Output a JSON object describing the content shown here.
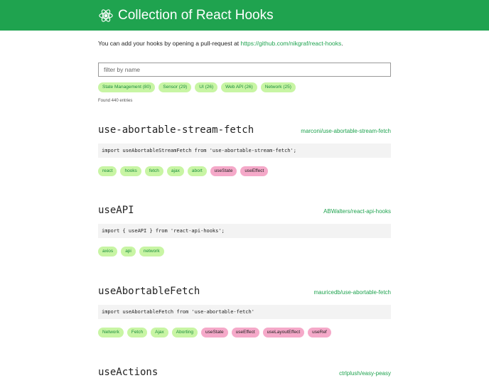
{
  "header": {
    "title": "Collection of React Hooks"
  },
  "intro": {
    "text": "You can add your hooks by opening a pull-request at ",
    "link": "https://github.com/nikgraf/react-hooks",
    "suffix": "."
  },
  "filter": {
    "placeholder": "filter by name",
    "value": ""
  },
  "categories": [
    "State Management (80)",
    "Sensor (29)",
    "UI (26)",
    "Web API (26)",
    "Network (25)"
  ],
  "found": "Found 440 entries",
  "entries": [
    {
      "name": "use-abortable-stream-fetch",
      "repo": "marconi/use-abortable-stream-fetch",
      "code": "import useAbortableStreamFetch from 'use-abortable-stream-fetch';",
      "tags": [
        "react",
        "hooks",
        "fetch",
        "ajax",
        "abort"
      ],
      "hooks": [
        "useState",
        "useEffect"
      ]
    },
    {
      "name": "useAPI",
      "repo": "ABWalters/react-api-hooks",
      "code": "import { useAPI } from 'react-api-hooks';",
      "tags": [
        "axios",
        "api",
        "network"
      ],
      "hooks": []
    },
    {
      "name": "useAbortableFetch",
      "repo": "mauricedb/use-abortable-fetch",
      "code": "import useAbortableFetch from 'use-abortable-fetch'",
      "tags": [
        "Network",
        "Fetch",
        "Ajax",
        "Aborting"
      ],
      "hooks": [
        "useState",
        "useEffect",
        "useLayoutEffect",
        "useRef"
      ]
    },
    {
      "name": "useActions",
      "repo": "ctrlplush/easy-peasy",
      "code": "",
      "tags": [],
      "hooks": []
    }
  ],
  "colors": {
    "brand": "#1fa34f",
    "tag": "#c8f5a4",
    "hook": "#f5a9c9"
  }
}
